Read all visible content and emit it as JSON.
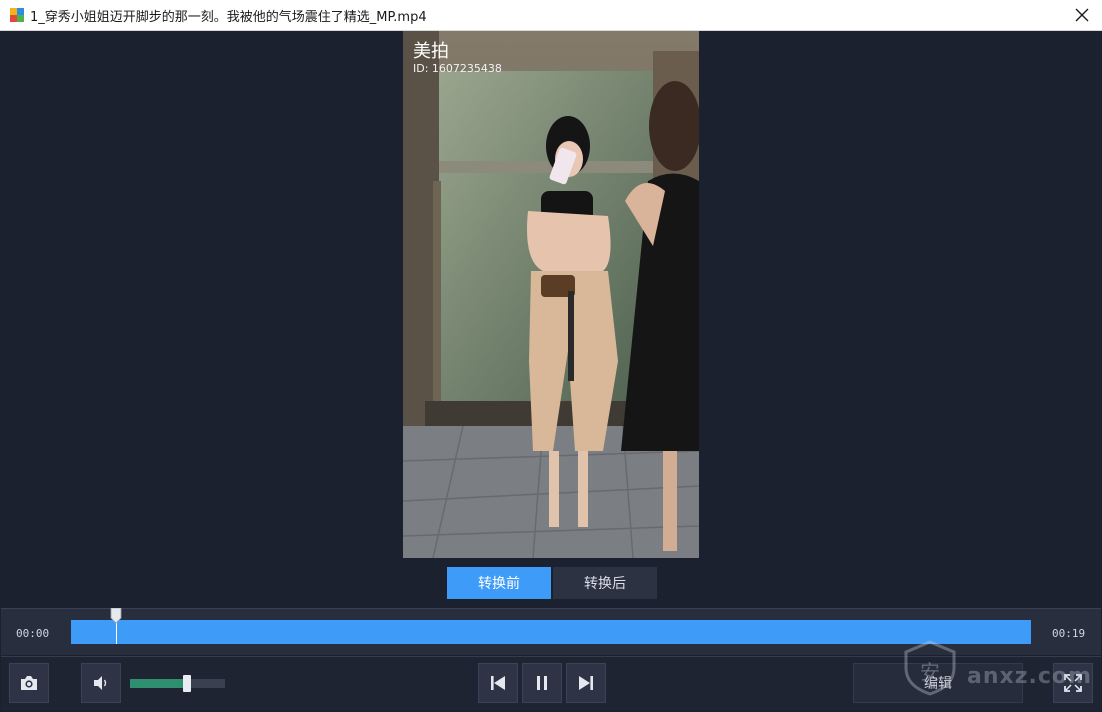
{
  "window": {
    "title": "1_穿秀小姐姐迈开脚步的那一刻。我被他的气场震住了精选_MP.mp4"
  },
  "video": {
    "watermark_brand": "美拍",
    "watermark_id": "ID: 1607235438"
  },
  "compare": {
    "before_label": "转换前",
    "after_label": "转换后",
    "active": "before"
  },
  "timeline": {
    "current_time": "00:00",
    "total_time": "00:19",
    "progress": 0.0
  },
  "controls": {
    "volume_level": 0.6,
    "edit_label": "编辑"
  },
  "watermark": {
    "logo_text": "安",
    "site_text": "anxz.com"
  },
  "icons": {
    "app": "app-icon",
    "close": "close-icon",
    "screenshot": "camera-icon",
    "volume": "speaker-icon",
    "prev": "skip-previous-icon",
    "pause": "pause-icon",
    "next": "skip-next-icon",
    "fullscreen": "fullscreen-icon"
  },
  "colors": {
    "accent": "#3e9bf7",
    "background": "#1c2130",
    "volume_fill": "#2f8f6e"
  }
}
